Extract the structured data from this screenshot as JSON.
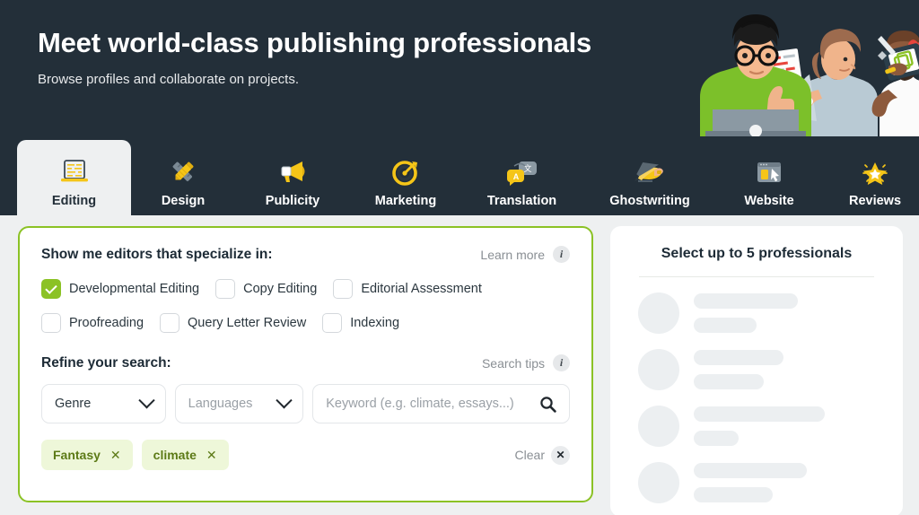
{
  "hero": {
    "title": "Meet world-class publishing professionals",
    "subtitle": "Browse profiles and collaborate on projects.",
    "background_color": "#232f39",
    "illustration": "three-publishing-professionals-illustration"
  },
  "tabs": [
    {
      "label": "Editing",
      "icon": "laptop-document-icon",
      "active": true
    },
    {
      "label": "Design",
      "icon": "pencil-ruler-icon",
      "active": false
    },
    {
      "label": "Publicity",
      "icon": "megaphone-icon",
      "active": false
    },
    {
      "label": "Marketing",
      "icon": "target-dart-icon",
      "active": false
    },
    {
      "label": "Translation",
      "icon": "speech-bubbles-language-icon",
      "active": false
    },
    {
      "label": "Ghostwriting",
      "icon": "hand-writing-pen-icon",
      "active": false
    },
    {
      "label": "Website",
      "icon": "browser-cursor-icon",
      "active": false
    },
    {
      "label": "Reviews",
      "icon": "sparkling-star-icon",
      "active": false
    }
  ],
  "filters": {
    "accent_color": "#8bc225",
    "specialize": {
      "label": "Show me editors that specialize in:",
      "learn_more_label": "Learn more",
      "info_icon": "info-icon",
      "options": [
        {
          "label": "Developmental Editing",
          "checked": true
        },
        {
          "label": "Copy Editing",
          "checked": false
        },
        {
          "label": "Editorial Assessment",
          "checked": false
        },
        {
          "label": "Proofreading",
          "checked": false
        },
        {
          "label": "Query Letter Review",
          "checked": false
        },
        {
          "label": "Indexing",
          "checked": false
        }
      ]
    },
    "refine": {
      "label": "Refine your search:",
      "search_tips_label": "Search tips",
      "info_icon": "info-icon",
      "genre_select": {
        "value": "Genre",
        "is_placeholder": false,
        "icon": "chevron-down-icon"
      },
      "languages_select": {
        "value": "Languages",
        "is_placeholder": true,
        "icon": "chevron-down-icon"
      },
      "keyword_input": {
        "value": "",
        "placeholder": "Keyword (e.g. climate, essays...)",
        "icon": "search-icon"
      }
    },
    "chips": [
      {
        "label": "Fantasy",
        "remove_icon": "close-icon"
      },
      {
        "label": "climate",
        "remove_icon": "close-icon"
      }
    ],
    "clear": {
      "label": "Clear",
      "icon": "close-icon"
    }
  },
  "results_panel": {
    "title": "Select up to 5 professionals",
    "skeleton_rows": [
      {
        "line1_width": 116,
        "line2_width": 70
      },
      {
        "line1_width": 100,
        "line2_width": 78
      },
      {
        "line1_width": 146,
        "line2_width": 50
      },
      {
        "line1_width": 126,
        "line2_width": 88
      }
    ]
  }
}
